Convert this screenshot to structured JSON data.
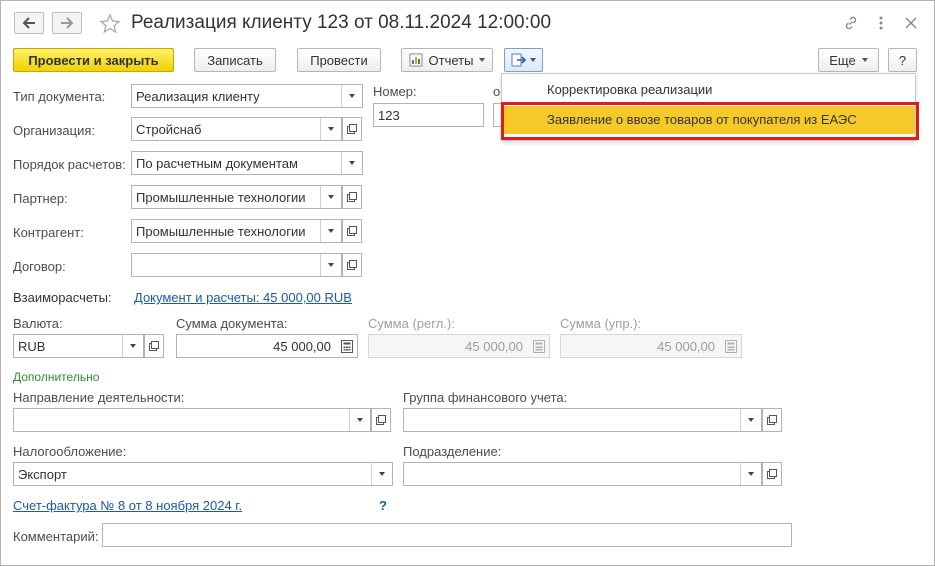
{
  "header": {
    "title": "Реализация клиенту 123 от 08.11.2024 12:00:00",
    "icons": [
      "back-arrow-icon",
      "forward-arrow-icon",
      "favorite-star-icon",
      "link-icon",
      "more-vertical-icon",
      "close-icon"
    ]
  },
  "toolbar": {
    "post_close": "Провести и закрыть",
    "save": "Записать",
    "post": "Провести",
    "reports": "Отчеты",
    "more": "Еще",
    "help": "?"
  },
  "create_menu": {
    "items": [
      {
        "label": "Корректировка реализации",
        "highlighted": false
      },
      {
        "label": "Заявление о ввозе товаров от покупателя из ЕАЭС",
        "highlighted": true
      }
    ]
  },
  "form": {
    "doc_type": {
      "label": "Тип документа:",
      "value": "Реализация клиенту"
    },
    "org": {
      "label": "Организация:",
      "value": "Стройснаб"
    },
    "payment_order": {
      "label": "Порядок расчетов:",
      "value": "По расчетным документам"
    },
    "partner": {
      "label": "Партнер:",
      "value": "Промышленные технологии"
    },
    "counterparty": {
      "label": "Контрагент:",
      "value": "Промышленные технологии"
    },
    "contract": {
      "label": "Договор:",
      "value": ""
    },
    "number": {
      "label": "Номер:",
      "value": "123"
    },
    "date_label_fragment": "о",
    "settlements": {
      "label": "Взаиморасчеты:",
      "link": "Документ и расчеты: 45 000,00 RUB"
    },
    "currency": {
      "label": "Валюта:",
      "value": "RUB"
    },
    "doc_sum": {
      "label": "Сумма документа:",
      "value": "45 000,00"
    },
    "sum_reg": {
      "label": "Сумма (регл.):",
      "value": "45 000,00"
    },
    "sum_mgmt": {
      "label": "Сумма (упр.):",
      "value": "45 000,00"
    },
    "additional": "Дополнительно",
    "activity": {
      "label": "Направление деятельности:",
      "value": ""
    },
    "fin_group": {
      "label": "Группа финансового учета:",
      "value": ""
    },
    "taxation": {
      "label": "Налогообложение:",
      "value": "Экспорт"
    },
    "department": {
      "label": "Подразделение:",
      "value": ""
    },
    "invoice_link": "Счет-фактура № 8 от 8 ноября 2024 г.",
    "invoice_help": "?",
    "comment": {
      "label": "Комментарий:",
      "value": ""
    }
  },
  "colors": {
    "primary_button": "#f1d200",
    "highlight": "#f5c928",
    "outline": "#e01b1b",
    "link": "#1a5aa8",
    "section_green": "#2f8a2f"
  }
}
